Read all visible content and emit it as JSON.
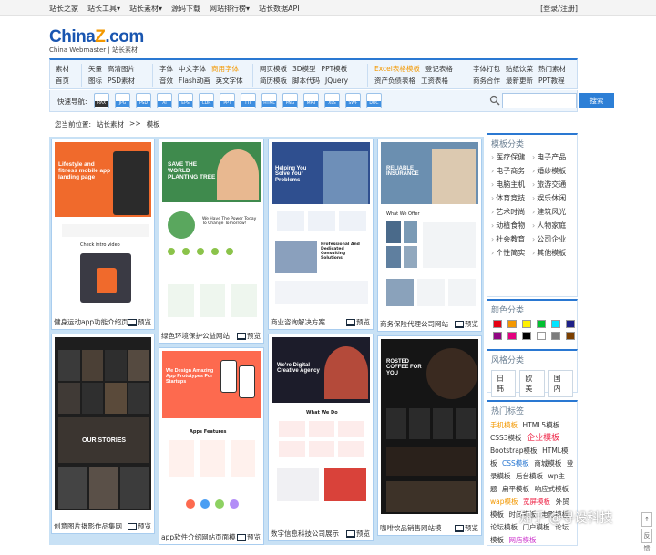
{
  "topbar": {
    "links": [
      "站长之家",
      "站长工具▾",
      "站长素材▾",
      "源码下载",
      "网站排行榜▾",
      "站长数据API"
    ],
    "login": "[登录/注册]"
  },
  "logo": {
    "brand_main": "China",
    "brand_z": "Z",
    "brand_tail": ".com",
    "subtitle": "China Webmaster | 站长素材"
  },
  "catnav": {
    "first": [
      "素材",
      "首页"
    ],
    "groups": [
      [
        [
          "矢量",
          "高清图片"
        ],
        [
          "图标",
          "PSD素材"
        ]
      ],
      [
        [
          "字体",
          "中文字体",
          "商用字体"
        ],
        [
          "音效",
          "Flash动画",
          "英文字体"
        ]
      ],
      [
        [
          "网页模板",
          "3D模型",
          "PPT模板"
        ],
        [
          "简历模板",
          "脚本代码",
          "JQuery"
        ]
      ],
      [
        [
          "Excel表格模板",
          "登记表格"
        ],
        [
          "资产负债表格",
          "工资表格"
        ]
      ],
      [
        [
          "字体打包",
          "贴纸饮菜",
          "热门素材"
        ],
        [
          "商务合作",
          "最新更新",
          "PPT教程"
        ]
      ]
    ],
    "highlights": [
      "商用字体",
      "Excel表格模板"
    ]
  },
  "formatbar": {
    "label": "快速导航:",
    "icons": [
      "RAX",
      "JPG",
      "PSD",
      "AI",
      "EPS",
      "CDR",
      "PPT",
      "TTF",
      "HTML",
      "PNG",
      "MP3",
      "XLS",
      "SWF",
      "DOC"
    ],
    "search_placeholder": "",
    "search_button": "搜索"
  },
  "breadcrumb": [
    "您当前位置:",
    "站长素材",
    ">>",
    "模板"
  ],
  "cards": [
    {
      "caption": "健身运动app功能介绍页",
      "preview": "预览",
      "hero": "Lifestyle and fitness mobile app landing page",
      "sub": "Check intro video"
    },
    {
      "caption": "绿色环境保护公益网站",
      "preview": "预览",
      "hero": "SAVE THE WORLD PLANTING TREE",
      "sub": "We Have The Power Today To Change Tomorrow!"
    },
    {
      "caption": "商业咨询解决方案",
      "preview": "预览",
      "hero": "Helping You Solve Your Problems",
      "sub": "Professional And Dedicated Consulting Solutions"
    },
    {
      "caption": "商务保险代理公司网站",
      "preview": "预览",
      "hero": "RELIABLE INSURANCE",
      "sub": "What We Offer"
    },
    {
      "caption": "创意图片摄影作品集网",
      "preview": "预览",
      "hero": "OUR STORIES",
      "sub": ""
    },
    {
      "caption": "app软件介绍网站页面模",
      "preview": "预览",
      "hero": "We Design Amazing App Prototypes For Startups",
      "sub": "Apps Features"
    },
    {
      "caption": "数字信息科技公司展示",
      "preview": "预览",
      "hero": "We're Digital Creative Agency",
      "sub": "What We Do"
    },
    {
      "caption": "咖啡饮品销售网站模",
      "preview": "预览",
      "hero": "ROSTED COFFEE FOR YOU",
      "sub": ""
    }
  ],
  "sidebar": {
    "categories_title": "模板分类",
    "categories": [
      "医疗保健",
      "电子产品",
      "电子商务",
      "婚纱模板",
      "电脑主机",
      "旅游交通",
      "体育竞技",
      "娱乐休闲",
      "艺术时尚",
      "建筑风光",
      "动植食物",
      "人物家庭",
      "社会教育",
      "公司企业",
      "个性简实",
      "其他模板"
    ],
    "colors_title": "颜色分类",
    "colors": [
      "#e60012",
      "#f39800",
      "#fff100",
      "#00c030",
      "#00e5ff",
      "#1d2088",
      "#920783",
      "#e4007f",
      "#000000",
      "#ffffff",
      "#7d7d7d",
      "#7b3f00"
    ],
    "styles_title": "风格分类",
    "styles": [
      "日韩",
      "欧美",
      "国内"
    ],
    "tags_title": "热门标签",
    "tags": [
      {
        "t": "手机模板",
        "c": "o"
      },
      {
        "t": "HTML5模板",
        "c": ""
      },
      {
        "t": "CSS3模板",
        "c": ""
      },
      {
        "t": "企业模板",
        "c": "big"
      },
      {
        "t": "Bootstrap模板",
        "c": ""
      },
      {
        "t": "HTML模板",
        "c": ""
      },
      {
        "t": "CSS模板",
        "c": "b"
      },
      {
        "t": "商城模板",
        "c": ""
      },
      {
        "t": "登录模板",
        "c": ""
      },
      {
        "t": "后台模板",
        "c": ""
      },
      {
        "t": "wp主题",
        "c": ""
      },
      {
        "t": "扁平模板",
        "c": ""
      },
      {
        "t": "响应式模板",
        "c": ""
      },
      {
        "t": "wap模板",
        "c": "o"
      },
      {
        "t": "宽屏模板",
        "c": "r"
      },
      {
        "t": "外贸模板",
        "c": ""
      },
      {
        "t": "时间模板",
        "c": ""
      },
      {
        "t": "电影模板",
        "c": ""
      },
      {
        "t": "论坛模板",
        "c": ""
      },
      {
        "t": "门户模板",
        "c": ""
      },
      {
        "t": "论坛模板",
        "c": ""
      },
      {
        "t": "网店模板",
        "c": "p"
      }
    ]
  },
  "watermark": "知乎 @寻设科技",
  "scroll": {
    "up": "↑",
    "feedback": "反馈"
  }
}
